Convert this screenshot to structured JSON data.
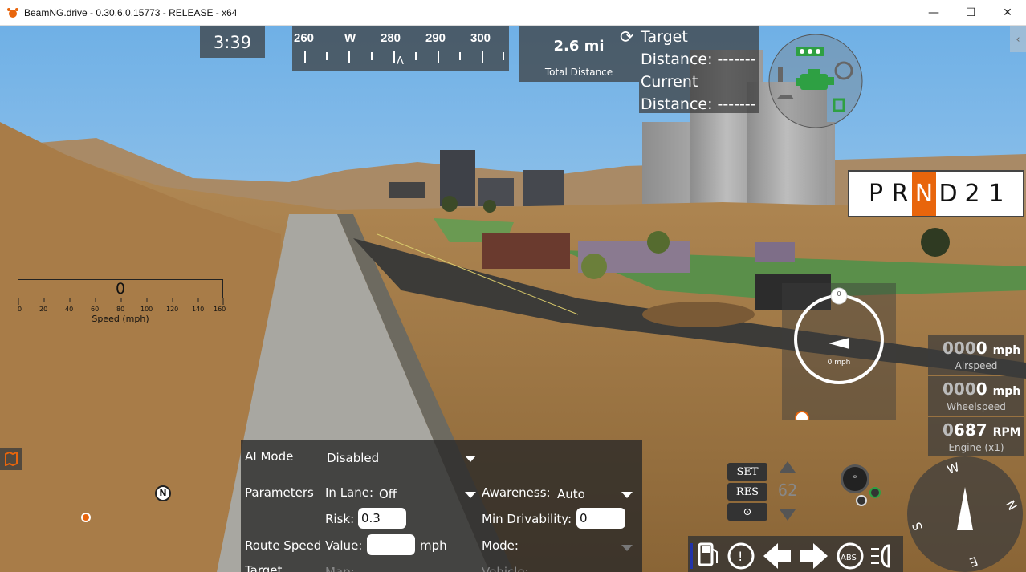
{
  "window": {
    "title": "BeamNG.drive - 0.30.6.0.15773 - RELEASE - x64",
    "minimize": "—",
    "maximize": "☐",
    "close": "✕"
  },
  "hud": {
    "clock": "3:39",
    "compass_strip": [
      "260",
      "W",
      "280",
      "290",
      "300"
    ],
    "compass_pointer": "Λ",
    "total_distance_value": "2.6 mi",
    "total_distance_label": "Total Distance",
    "target_line1": "Target",
    "target_line2": "Distance: -------",
    "current_line1": "Current",
    "current_line2": "Distance: -------",
    "gears": [
      "P",
      "R",
      "N",
      "D",
      "2",
      "1"
    ],
    "active_gear": "N",
    "speed_bar_value": "0",
    "speed_bar_ticks": [
      "0",
      "20",
      "40",
      "60",
      "80",
      "100",
      "120",
      "140",
      "160"
    ],
    "speed_bar_label": "Speed (mph)",
    "speedo_top": "0",
    "speedo_value": "0 mph",
    "airspeed_prefix": "000",
    "airspeed_digit": "0",
    "airspeed_unit": "mph",
    "airspeed_label": "Airspeed",
    "wheelspeed_prefix": "000",
    "wheelspeed_digit": "0",
    "wheelspeed_unit": "mph",
    "wheelspeed_label": "Wheelspeed",
    "rpm_prefix": "0",
    "rpm_digits": "687",
    "rpm_unit": "RPM",
    "rpm_label": "Engine (x1)",
    "cruise_set": "SET",
    "cruise_res": "RES",
    "minimap_marker": "N",
    "nav_compass": [
      "W",
      "N",
      "S",
      "E"
    ]
  },
  "ai_panel": {
    "ai_mode_label": "AI Mode",
    "ai_mode_value": "Disabled",
    "parameters_label": "Parameters",
    "in_lane_label": "In Lane:",
    "in_lane_value": "Off",
    "awareness_label": "Awareness:",
    "awareness_value": "Auto",
    "risk_label": "Risk:",
    "risk_value": "0.3",
    "min_drivability_label": "Min Drivability:",
    "min_drivability_value": "0",
    "route_speed_label": "Route Speed Value:",
    "route_speed_value": "",
    "route_speed_unit": "mph",
    "mode_label": "Mode:",
    "target_label": "Target",
    "map_label": "Map:",
    "vehicle_label": "Vehicle:"
  },
  "colors": {
    "accent_orange": "#e8650c",
    "engine_green": "#2ea043",
    "hud_dark": "#3c3c3c"
  }
}
